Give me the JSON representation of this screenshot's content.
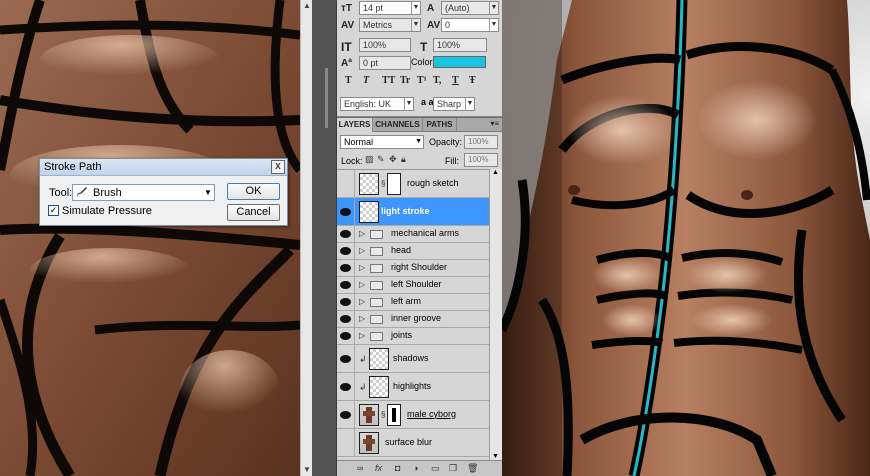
{
  "stroke_dialog": {
    "title": "Stroke Path",
    "tool_label": "Tool:",
    "tool_value": "Brush",
    "simulate_label": "Simulate Pressure",
    "simulate_checked": true,
    "ok_label": "OK",
    "cancel_label": "Cancel",
    "close_glyph": "x"
  },
  "character_panel": {
    "font_size": "14 pt",
    "leading": "(Auto)",
    "kerning": "Metrics",
    "tracking": "0",
    "vertical_scale": "100%",
    "horizontal_scale": "100%",
    "baseline_shift": "0 pt",
    "color_label": "Color:",
    "color_value": "#19c4e0",
    "style_buttons": [
      "T",
      "T",
      "TT",
      "Tr",
      "T¹",
      "T,",
      "T",
      "Ŧ"
    ],
    "language": "English: UK",
    "anti_alias_label": "a a",
    "anti_alias": "Sharp"
  },
  "layers_panel": {
    "tabs": [
      "LAYERS",
      "CHANNELS",
      "PATHS"
    ],
    "active_tab": "LAYERS",
    "blend_mode": "Normal",
    "opacity_label": "Opacity:",
    "opacity_value": "100%",
    "lock_label": "Lock:",
    "fill_label": "Fill:",
    "fill_value": "100%",
    "layers": [
      {
        "name": "rough sketch",
        "kind": "masked",
        "visible": false,
        "selected": false
      },
      {
        "name": "light stroke",
        "kind": "layer",
        "visible": true,
        "selected": true
      },
      {
        "name": "mechanical arms",
        "kind": "group",
        "visible": true,
        "selected": false
      },
      {
        "name": "head",
        "kind": "group",
        "visible": true,
        "selected": false
      },
      {
        "name": "right Shoulder",
        "kind": "group",
        "visible": true,
        "selected": false
      },
      {
        "name": "left Shoulder",
        "kind": "group",
        "visible": true,
        "selected": false
      },
      {
        "name": "left arm",
        "kind": "group",
        "visible": true,
        "selected": false
      },
      {
        "name": "inner groove",
        "kind": "group",
        "visible": true,
        "selected": false
      },
      {
        "name": "joints",
        "kind": "group",
        "visible": true,
        "selected": false
      },
      {
        "name": "shadows",
        "kind": "clipped",
        "visible": true,
        "selected": false
      },
      {
        "name": "highlights",
        "kind": "clipped",
        "visible": true,
        "selected": false
      },
      {
        "name": "male cyborg",
        "kind": "masked",
        "visible": true,
        "selected": false
      },
      {
        "name": "surface blur",
        "kind": "photo",
        "visible": false,
        "selected": false
      }
    ],
    "footer_icons": [
      "link-icon",
      "fx-icon",
      "mask-icon",
      "adjustment-icon",
      "group-icon",
      "new-layer-icon",
      "trash-icon"
    ]
  }
}
